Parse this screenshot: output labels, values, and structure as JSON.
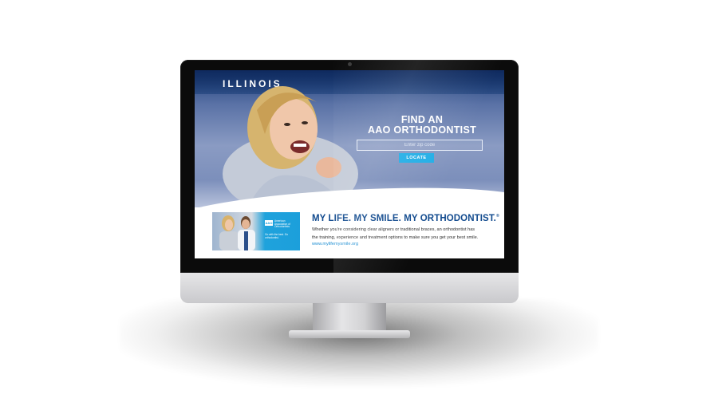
{
  "hero": {
    "state": "ILLINOIS",
    "cta_line1": "FIND AN",
    "cta_line2": "AAO ORTHODONTIST",
    "zip_placeholder": "Enter zip code",
    "locate_label": "LOCATE"
  },
  "promo": {
    "headline": "MY LIFE. MY SMILE. MY ORTHODONTIST.",
    "trademark": "®",
    "body_line1": "Whether you're considering clear aligners or traditional braces, an orthodontist has",
    "body_line2": "the training, experience and treatment options to make sure you get your best smile.",
    "link": "www.mylifemysmile.org",
    "ad": {
      "logo": "AAO",
      "org_line1": "American",
      "org_line2": "Association of",
      "org_line3": "Orthodontists",
      "tagline": "Go with the best. Go orthodontist."
    }
  },
  "colors": {
    "brand_blue": "#114a8e",
    "accent_cyan": "#22aee6",
    "link_blue": "#1f8fd3"
  },
  "icons": {
    "camera": "camera-dot-icon"
  }
}
